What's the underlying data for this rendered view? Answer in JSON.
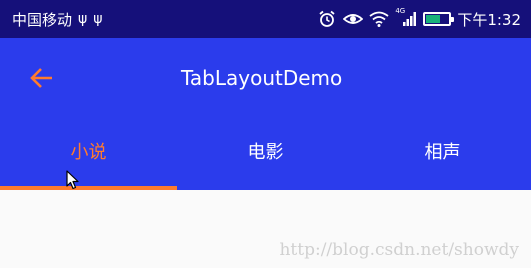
{
  "status_bar": {
    "carrier": "中国移动",
    "usb_icon_1": "ψ",
    "usb_icon_2": "ψ",
    "network_label": "4G",
    "time": "下午1:32",
    "battery_level": 0.55,
    "icons": [
      "alarm-icon",
      "eye-icon",
      "wifi-icon",
      "signal-icon",
      "battery-icon"
    ]
  },
  "toolbar": {
    "back_icon": "arrow-back-icon",
    "title": "TabLayoutDemo",
    "background": "#2b3cec"
  },
  "tabs": [
    {
      "label": "小说",
      "selected": true
    },
    {
      "label": "电影",
      "selected": false
    },
    {
      "label": "相声",
      "selected": false
    }
  ],
  "colors": {
    "status_bar_bg": "#15107a",
    "toolbar_bg": "#2b3cec",
    "accent": "#ff7b2e",
    "battery_fill": "#19b27a"
  },
  "watermark": "http://blog.csdn.net/showdy"
}
